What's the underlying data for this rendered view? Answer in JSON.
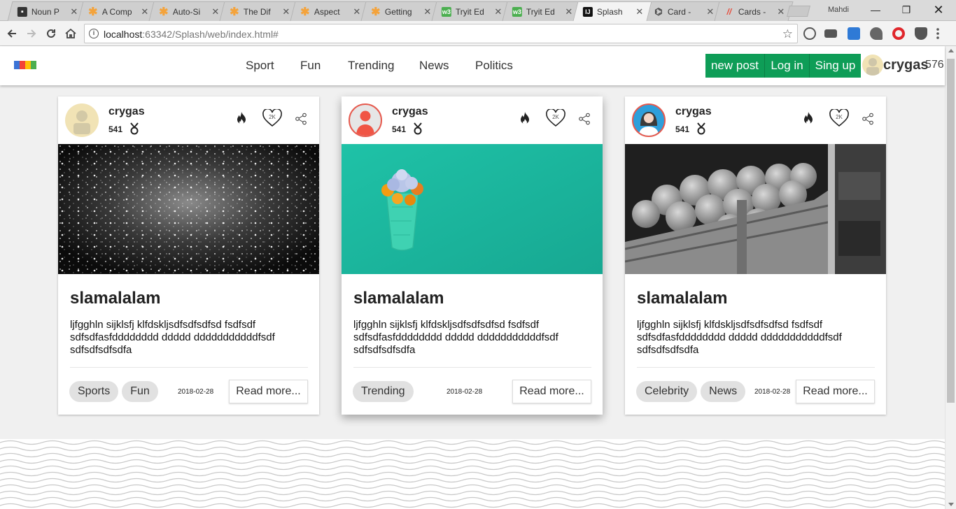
{
  "browser": {
    "tabs": [
      {
        "title": "Noun P",
        "favicon": "noun-project-icon",
        "color": "#333333"
      },
      {
        "title": "A Comp",
        "favicon": "asterisk-icon",
        "color": "#f4a33b"
      },
      {
        "title": "Auto-Si",
        "favicon": "asterisk-icon",
        "color": "#f4a33b"
      },
      {
        "title": "The Dif",
        "favicon": "asterisk-icon",
        "color": "#f4a33b"
      },
      {
        "title": "Aspect",
        "favicon": "asterisk-icon",
        "color": "#f4a33b"
      },
      {
        "title": "Getting",
        "favicon": "asterisk-icon",
        "color": "#f4a33b"
      },
      {
        "title": "Tryit Ed",
        "favicon": "w3-icon",
        "color": "#4caf50"
      },
      {
        "title": "Tryit Ed",
        "favicon": "w3-icon",
        "color": "#4caf50"
      },
      {
        "title": "Splash",
        "favicon": "intellij-icon",
        "color": "#111111"
      },
      {
        "title": "Card -",
        "favicon": "codepen-icon",
        "color": "#444444"
      },
      {
        "title": "Cards -",
        "favicon": "cards-icon",
        "color": "#e74c3c"
      }
    ],
    "user_label": "Mahdi",
    "url_host": "localhost",
    "url_rest": ":63342/Splash/web/index.html#"
  },
  "site": {
    "nav": [
      "Sport",
      "Fun",
      "Trending",
      "News",
      "Politics"
    ],
    "buttons": {
      "new_post": "new post",
      "login": "Log in",
      "signup": "Sing up"
    },
    "user": {
      "name": "crygas",
      "count": "576"
    },
    "logo_colors": [
      "#3b73d6",
      "#f44336",
      "#ffc107",
      "#4caf50"
    ],
    "accent_color": "#0e9d57"
  },
  "cards": [
    {
      "author": "crygas",
      "score": "541",
      "likes": "2K",
      "image": "sparkling-particles-image",
      "title": "slamalalam",
      "body": "ljfgghln sijklsfj klfdskljsdfsdfsdfsd fsdfsdf sdfsdfasfdddddddd ddddd dddddddddddfsdf sdfsdfsdfsdfa",
      "tags": [
        "Sports",
        "Fun"
      ],
      "date": "2018-02-28",
      "read_more": "Read more..."
    },
    {
      "author": "crygas",
      "score": "541",
      "likes": "2K",
      "image": "flowers-on-teal-wall-image",
      "title": "slamalalam",
      "body": "ljfgghln sijklsfj klfdskljsdfsdfsdfsd fsdfsdf sdfsdfasfdddddddd ddddd dddddddddddfsdf sdfsdfsdfsdfa",
      "tags": [
        "Trending"
      ],
      "date": "2018-02-28",
      "read_more": "Read more..."
    },
    {
      "author": "crygas",
      "score": "541",
      "likes": "2K",
      "image": "crates-of-fruit-image",
      "title": "slamalalam",
      "body": "ljfgghln sijklsfj klfdskljsdfsdfsdfsd fsdfsdf sdfsdfasfdddddddd ddddd dddddddddddfsdf sdfsdfsdfsdfa",
      "tags": [
        "Celebrity",
        "News"
      ],
      "date": "2018-02-28",
      "read_more": "Read more..."
    }
  ]
}
